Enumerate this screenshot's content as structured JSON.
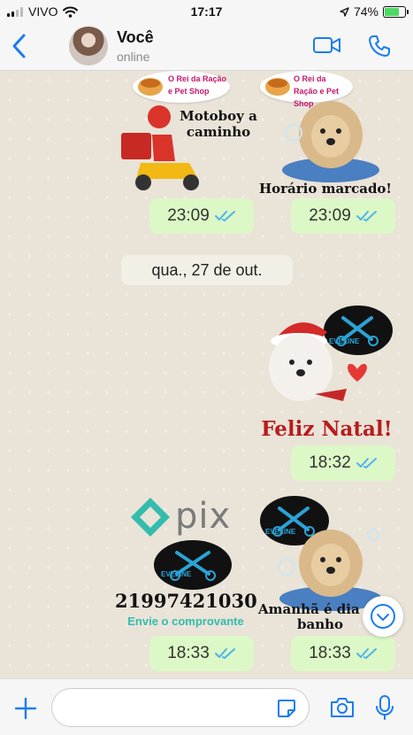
{
  "status_bar": {
    "carrier": "VIVO",
    "time": "17:17",
    "battery": "74%",
    "battery_level": 0.74
  },
  "header": {
    "contact_name": "Você",
    "contact_status": "online"
  },
  "chat": {
    "date_divider": "qua., 27 de out.",
    "messages": [
      {
        "kind": "sticker",
        "logo_text": "O Rei da Ração e Pet Shop",
        "caption": "Motoboy a caminho",
        "time": "23:09"
      },
      {
        "kind": "sticker",
        "logo_text": "O Rei da Ração e Pet Shop",
        "caption": "Horário marcado!",
        "time": "23:09"
      },
      {
        "kind": "sticker",
        "caption": "Feliz Natal!",
        "time": "18:32"
      },
      {
        "kind": "sticker",
        "logo_word": "pix",
        "phone": "21997421030",
        "note": "Envie o comprovante",
        "time": "18:33"
      },
      {
        "kind": "sticker",
        "caption": "Amanhã é dia de banho",
        "time": "18:33"
      }
    ],
    "brand_label": "EVELINE"
  },
  "colors": {
    "accent": "#1a7cf2",
    "bubble": "#dcf8c6",
    "ticks": "#4fb3ec",
    "pix": "#32bcad",
    "brand_blue": "#2ba3d6"
  },
  "input_bar": {
    "placeholder": ""
  }
}
